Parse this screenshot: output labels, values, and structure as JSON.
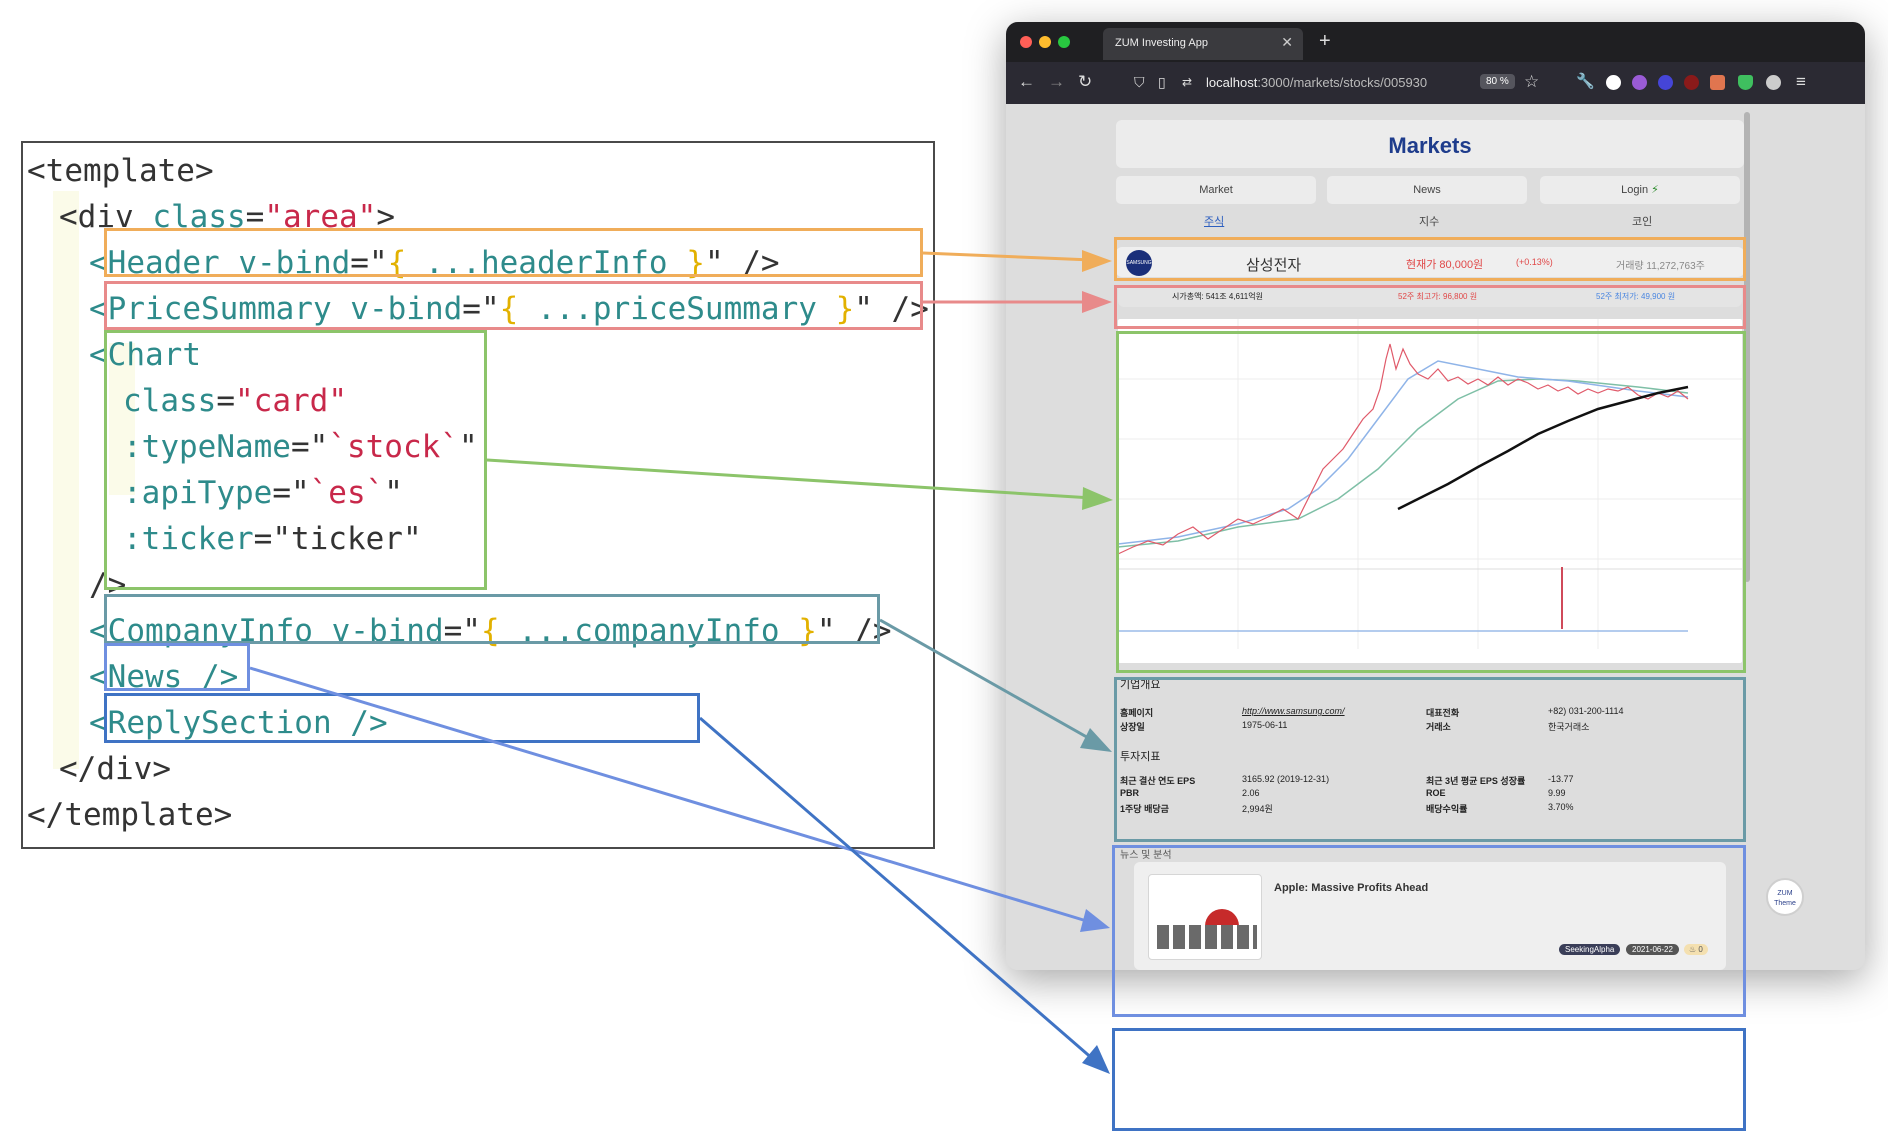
{
  "code": {
    "lines": [
      [
        {
          "t": "<template>",
          "c": "t-tag"
        }
      ],
      [
        {
          "t": "<div ",
          "c": "t-tag"
        },
        {
          "t": "class",
          "c": "t-attr"
        },
        {
          "t": "=",
          "c": "t-plain"
        },
        {
          "t": "\"area\"",
          "c": "t-str"
        },
        {
          "t": ">",
          "c": "t-tag"
        }
      ],
      [
        {
          "t": "<Header ",
          "c": "t-comp"
        },
        {
          "t": "v-bind",
          "c": "t-attr"
        },
        {
          "t": "=\"",
          "c": "t-plain"
        },
        {
          "t": "{",
          "c": "t-brace"
        },
        {
          "t": " ...headerInfo ",
          "c": "t-comp"
        },
        {
          "t": "}",
          "c": "t-brace"
        },
        {
          "t": "\" />",
          "c": "t-plain"
        }
      ],
      [
        {
          "t": "<PriceSummary ",
          "c": "t-comp"
        },
        {
          "t": "v-bind",
          "c": "t-attr"
        },
        {
          "t": "=\"",
          "c": "t-plain"
        },
        {
          "t": "{",
          "c": "t-brace"
        },
        {
          "t": " ...priceSummary ",
          "c": "t-comp"
        },
        {
          "t": "}",
          "c": "t-brace"
        },
        {
          "t": "\" />",
          "c": "t-plain"
        }
      ],
      [
        {
          "t": "<Chart",
          "c": "t-comp"
        }
      ],
      [
        {
          "t": "class",
          "c": "t-attr"
        },
        {
          "t": "=",
          "c": "t-plain"
        },
        {
          "t": "\"card\"",
          "c": "t-str"
        }
      ],
      [
        {
          "t": ":typeName",
          "c": "t-attr"
        },
        {
          "t": "=\"",
          "c": "t-plain"
        },
        {
          "t": "`stock`",
          "c": "t-str"
        },
        {
          "t": "\"",
          "c": "t-plain"
        }
      ],
      [
        {
          "t": ":apiType",
          "c": "t-attr"
        },
        {
          "t": "=\"",
          "c": "t-plain"
        },
        {
          "t": "`es`",
          "c": "t-str"
        },
        {
          "t": "\"",
          "c": "t-plain"
        }
      ],
      [
        {
          "t": ":ticker",
          "c": "t-attr"
        },
        {
          "t": "=\"ticker\"",
          "c": "t-plain"
        }
      ],
      [
        {
          "t": "/>",
          "c": "t-plain"
        }
      ],
      [
        {
          "t": "<CompanyInfo ",
          "c": "t-comp"
        },
        {
          "t": "v-bind",
          "c": "t-attr"
        },
        {
          "t": "=\"",
          "c": "t-plain"
        },
        {
          "t": "{",
          "c": "t-brace"
        },
        {
          "t": " ...companyInfo ",
          "c": "t-comp"
        },
        {
          "t": "}",
          "c": "t-brace"
        },
        {
          "t": "\" />",
          "c": "t-plain"
        }
      ],
      [
        {
          "t": "<News />",
          "c": "t-comp"
        }
      ],
      [
        {
          "t": "<ReplySection />",
          "c": "t-comp"
        }
      ],
      [
        {
          "t": "</div>",
          "c": "t-tag"
        }
      ],
      [
        {
          "t": "</template>",
          "c": "t-tag"
        }
      ]
    ]
  },
  "browser": {
    "tab_title": "ZUM Investing App",
    "url_host": "localhost",
    "url_path": ":3000/markets/stocks/005930",
    "zoom": "80 %",
    "side_widget": [
      "ZUM",
      "Theme"
    ]
  },
  "page": {
    "title": "Markets",
    "menu": [
      "Market",
      "News",
      "Login"
    ],
    "subtabs": [
      "주식",
      "지수",
      "코인"
    ],
    "header": {
      "logo_text": "SAMSUNG",
      "name": "삼성전자",
      "price": "현재가 80,000원",
      "change": "(+0.13%)",
      "volume": "거래량 11,272,763주"
    },
    "price_summary": {
      "market_cap": "시가총액: 541조 4,611억원",
      "high_52w": "52주 최고가: 96,800 원",
      "low_52w": "52주 최저가: 49,900 원"
    },
    "company_info": {
      "section_title": "기업개요",
      "rows": [
        {
          "label": "홈페이지",
          "value": "http://www.samsung.com/",
          "label2": "대표전화",
          "value2": "+82) 031-200-1114"
        },
        {
          "label": "상장일",
          "value": "1975-06-11",
          "label2": "거래소",
          "value2": "한국거래소"
        }
      ],
      "indicators_title": "투자지표",
      "indicators": [
        {
          "label": "최근 결산 연도 EPS",
          "value": "3165.92 (2019-12-31)",
          "label2": "최근 3년 평균 EPS 성장률",
          "value2": "-13.77"
        },
        {
          "label": "PBR",
          "value": "2.06",
          "label2": "ROE",
          "value2": "9.99"
        },
        {
          "label": "1주당 배당금",
          "value": "2,994원",
          "label2": "배당수익률",
          "value2": "3.70%"
        }
      ]
    },
    "news": {
      "section_title": "뉴스 및 분석",
      "item_title": "Apple: Massive Profits Ahead",
      "source": "SeekingAlpha",
      "date": "2021-06-22",
      "count": "0"
    }
  },
  "colors": {
    "header_box": "#f0ad5a",
    "price_box": "#e88a8a",
    "chart_box": "#8cc46a",
    "company_box": "#6a9aa6",
    "news_box": "#6f8fe0",
    "reply_box": "#3f73c4",
    "title_blue": "#1e3c8c",
    "price_red": "#e04848",
    "low_blue": "#4a86e0"
  }
}
